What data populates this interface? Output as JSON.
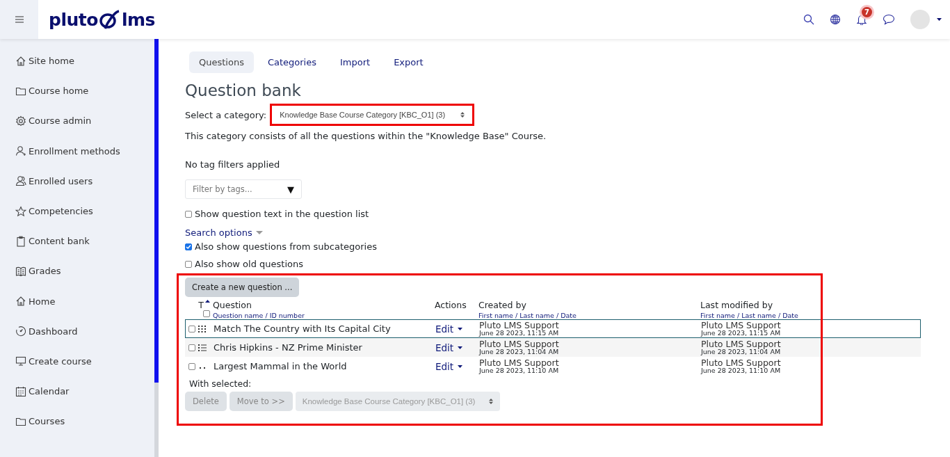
{
  "header": {
    "logo": {
      "left": "pluto",
      "right": "lms"
    },
    "notification_count": "7"
  },
  "sidebar": {
    "items": [
      {
        "label": "Site home"
      },
      {
        "label": "Course home"
      },
      {
        "label": "Course admin"
      },
      {
        "label": "Enrollment methods"
      },
      {
        "label": "Enrolled users"
      },
      {
        "label": "Competencies"
      },
      {
        "label": "Content bank"
      },
      {
        "label": "Grades"
      },
      {
        "label": "Home"
      },
      {
        "label": "Dashboard"
      },
      {
        "label": "Create course"
      },
      {
        "label": "Calendar"
      },
      {
        "label": "Courses"
      }
    ]
  },
  "tabs": [
    {
      "label": "Questions",
      "selected": true
    },
    {
      "label": "Categories",
      "selected": false
    },
    {
      "label": "Import",
      "selected": false
    },
    {
      "label": "Export",
      "selected": false
    }
  ],
  "title": "Question bank",
  "category": {
    "label": "Select a category:",
    "value": "Knowledge Base Course Category [KBC_O1] (3)"
  },
  "description": "This category consists of all the questions within the \"Knowledge Base\" Course.",
  "tag_status": "No tag filters applied",
  "tag_filter": {
    "placeholder": "Filter by tags...",
    "arrow": "▼"
  },
  "show_text": {
    "label": "Show question text in the question list",
    "checked": false
  },
  "search_options": {
    "label": "Search options"
  },
  "options": [
    {
      "label": "Also show questions from subcategories",
      "checked": true
    },
    {
      "label": "Also show old questions",
      "checked": false
    }
  ],
  "create_button": "Create a new question ...",
  "table": {
    "columns": [
      {
        "label": "T"
      },
      {
        "label": "Question",
        "sub": "Question name / ID number"
      },
      {
        "label": "Actions"
      },
      {
        "label": "Created by",
        "sub": "First name / Last name / Date"
      },
      {
        "label": "Last modified by",
        "sub": "First name / Last name / Date"
      }
    ],
    "select_all_checked": false,
    "rows": [
      {
        "checked": false,
        "focused": true,
        "kind": "matching",
        "name": "Match The Country with Its Capital City",
        "action": "Edit",
        "created_by": "Pluto LMS Support",
        "created_date": "June 28 2023, 11:15 AM",
        "modified_by": "Pluto LMS Support",
        "modified_date": "June 28 2023, 11:15 AM"
      },
      {
        "checked": false,
        "focused": false,
        "kind": "multichoice",
        "name": "Chris Hipkins - NZ Prime Minister",
        "action": "Edit",
        "created_by": "Pluto LMS Support",
        "created_date": "June 28 2023, 11:04 AM",
        "modified_by": "Pluto LMS Support",
        "modified_date": "June 28 2023, 11:04 AM"
      },
      {
        "checked": false,
        "focused": false,
        "kind": "truefalse",
        "name": "Largest Mammal in the World",
        "action": "Edit",
        "created_by": "Pluto LMS Support",
        "created_date": "June 28 2023, 11:10 AM",
        "modified_by": "Pluto LMS Support",
        "modified_date": "June 28 2023, 11:10 AM"
      }
    ]
  },
  "with_selected": {
    "label": "With selected:",
    "buttons": [
      "Delete",
      "Move to >>"
    ],
    "target": "Knowledge Base Course Category [KBC_O1] (3)"
  }
}
